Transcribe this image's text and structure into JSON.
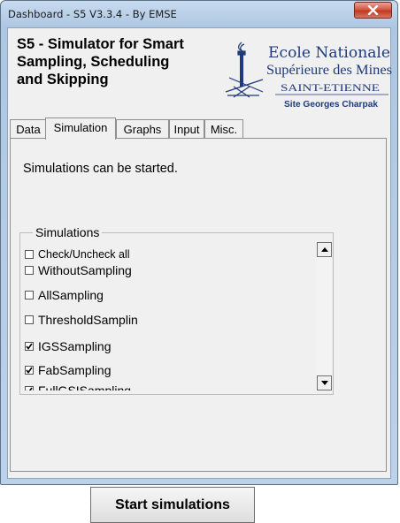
{
  "window": {
    "title": "Dashboard - S5 V3.3.4 - By EMSE",
    "close_glyph": "✕"
  },
  "app": {
    "title_line1": "S5 - Simulator for Smart",
    "title_line2": "Sampling, Scheduling",
    "title_line3": "and Skipping"
  },
  "logo": {
    "line1": "Ecole Nationale",
    "line2": "Supérieure des Mines",
    "line3": "SAINT-ETIENNE",
    "line4": "Site Georges Charpak",
    "icon": "mines-torch-logo",
    "color": "#1e3a7a"
  },
  "tabs": [
    {
      "label": "Data",
      "active": false
    },
    {
      "label": "Simulation",
      "active": true
    },
    {
      "label": "Graphs",
      "active": false
    },
    {
      "label": "Input",
      "active": false
    },
    {
      "label": "Misc.",
      "active": false
    }
  ],
  "simulation": {
    "status": "Simulations can be started.",
    "group_label": "Simulations",
    "items": [
      {
        "label": "Check/Uncheck all",
        "checked": false
      },
      {
        "label": "WithoutSampling",
        "checked": false
      },
      {
        "label": "AllSampling",
        "checked": false
      },
      {
        "label": "ThresholdSamplin",
        "checked": false
      },
      {
        "label": "IGSSampling",
        "checked": true
      },
      {
        "label": "FabSampling",
        "checked": true
      },
      {
        "label": "FullGSISampling",
        "checked": true
      }
    ],
    "start_button": "Start simulations"
  }
}
